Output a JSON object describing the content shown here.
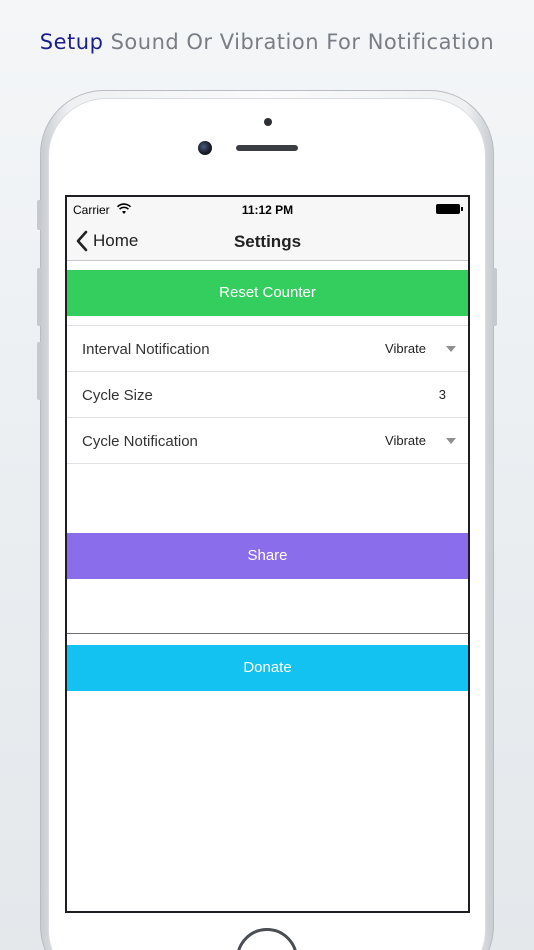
{
  "headline": {
    "accent": "Setup",
    "rest": "Sound Or Vibration For Notification"
  },
  "statusbar": {
    "carrier": "Carrier",
    "time": "11:12 PM",
    "icons": [
      "wifi-icon",
      "battery-icon"
    ]
  },
  "navbar": {
    "back_label": "Home",
    "title": "Settings",
    "back_icon": "chevron-left-icon"
  },
  "buttons": {
    "reset": "Reset Counter",
    "share": "Share",
    "donate": "Donate"
  },
  "settings": {
    "interval": {
      "label": "Interval Notification",
      "value": "Vibrate"
    },
    "cycle_size": {
      "label": "Cycle Size",
      "value": "3"
    },
    "cycle_notification": {
      "label": "Cycle Notification",
      "value": "Vibrate"
    }
  },
  "colors": {
    "reset": "#34ce5f",
    "share": "#8a6dea",
    "donate": "#14c2f2",
    "headline_accent": "#1b1f8a"
  }
}
